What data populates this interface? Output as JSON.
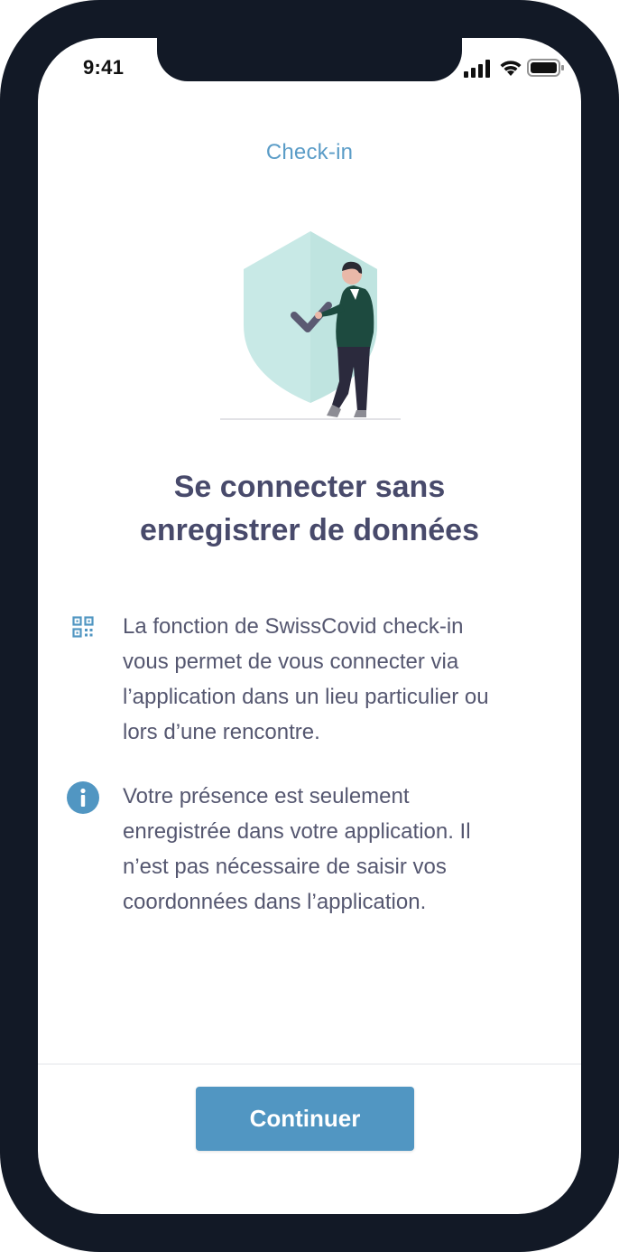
{
  "status_bar": {
    "time": "9:41",
    "icons": [
      "cellular-signal-icon",
      "wifi-icon",
      "battery-icon"
    ]
  },
  "nav": {
    "title": "Check-in"
  },
  "illustration": {
    "name": "shield-person-checkmark-illustration"
  },
  "headline": {
    "line1": "Se connecter sans",
    "line2": "enregistrer de données"
  },
  "info_items": [
    {
      "icon": "qr-code-icon",
      "lines": [
        "La fonction de SwissCovid check-in",
        "vous permet de vous connecter via",
        "l’application dans un lieu particulier ou",
        "lors d’une rencontre."
      ]
    },
    {
      "icon": "info-icon",
      "lines": [
        "Votre présence est seulement",
        "enregistrée dans votre application. Il",
        "n’est pas nécessaire de saisir vos",
        "coordonnées dans l’application."
      ]
    }
  ],
  "footer": {
    "continue_label": "Continuer"
  },
  "colors": {
    "frame": "#121926",
    "accent": "#5196c2",
    "nav_title": "#5a9cc7",
    "headline": "#484a6b",
    "body_text": "#555770",
    "shield": "#c8e9e6",
    "jacket": "#1d4a3f",
    "pants": "#2b2a3d"
  }
}
